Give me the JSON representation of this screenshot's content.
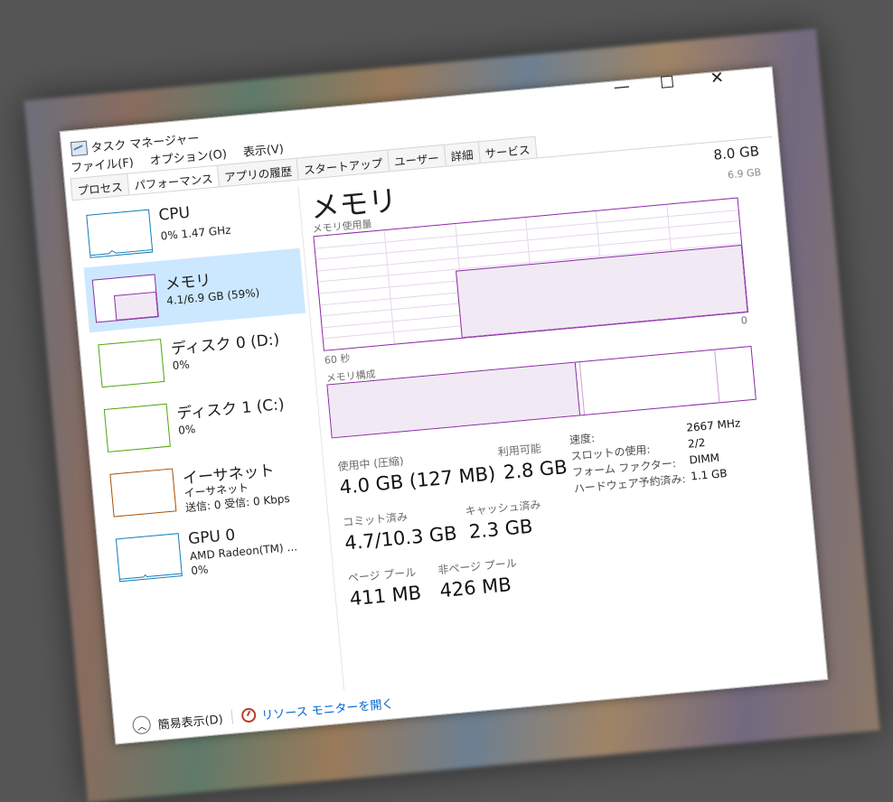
{
  "window": {
    "title": "タスク マネージャー",
    "min_glyph": "—",
    "close_glyph": "✕"
  },
  "menu": [
    "ファイル(F)",
    "オプション(O)",
    "表示(V)"
  ],
  "tabs": [
    {
      "label": "プロセス",
      "active": false
    },
    {
      "label": "パフォーマンス",
      "active": true
    },
    {
      "label": "アプリの履歴",
      "active": false
    },
    {
      "label": "スタートアップ",
      "active": false
    },
    {
      "label": "ユーザー",
      "active": false
    },
    {
      "label": "詳細",
      "active": false
    },
    {
      "label": "サービス",
      "active": false
    }
  ],
  "sidebar": [
    {
      "name": "CPU",
      "line1": "0% 1.47 GHz",
      "line2": "",
      "line3": "",
      "color": "#117dbb",
      "selected": false
    },
    {
      "name": "メモリ",
      "line1": "4.1/6.9 GB (59%)",
      "line2": "",
      "line3": "",
      "color": "#8b2aa6",
      "selected": true
    },
    {
      "name": "ディスク 0 (D:)",
      "line1": "0%",
      "line2": "",
      "line3": "",
      "color": "#4da60c",
      "selected": false
    },
    {
      "name": "ディスク 1 (C:)",
      "line1": "0%",
      "line2": "",
      "line3": "",
      "color": "#4da60c",
      "selected": false
    },
    {
      "name": "イーサネット",
      "line1": "イーサネット",
      "line2": "送信: 0 受信: 0 Kbps",
      "line3": "",
      "color": "#a74f01",
      "selected": false
    },
    {
      "name": "GPU 0",
      "line1": "AMD Radeon(TM) ...",
      "line2": "0%",
      "line3": "",
      "color": "#117dbb",
      "selected": false
    }
  ],
  "main": {
    "title": "メモリ",
    "total": "8.0 GB",
    "max_label": "6.9 GB",
    "usage_label": "メモリ使用量",
    "zero_label": "0",
    "time_label": "60 秒",
    "composition_label": "メモリ構成",
    "usage_level": 0.59,
    "composition": {
      "in_use": 0.585,
      "modified": 0.01,
      "standby": 0.32,
      "free": 0.085
    },
    "stats": {
      "in_use_label": "使用中 (圧縮)",
      "in_use_value": "4.0 GB (127 MB)",
      "available_label": "利用可能",
      "available_value": "2.8 GB",
      "committed_label": "コミット済み",
      "committed_value": "4.7/10.3 GB",
      "cached_label": "キャッシュ済み",
      "cached_value": "2.3 GB",
      "paged_label": "ページ プール",
      "paged_value": "411 MB",
      "nonpaged_label": "非ページ プール",
      "nonpaged_value": "426 MB"
    },
    "specs": [
      {
        "label": "速度:",
        "value": "2667 MHz"
      },
      {
        "label": "スロットの使用:",
        "value": "2/2"
      },
      {
        "label": "フォーム ファクター:",
        "value": "DIMM"
      },
      {
        "label": "ハードウェア予約済み:",
        "value": "1.1 GB"
      }
    ]
  },
  "footer": {
    "fewer_details": "簡易表示(D)",
    "resource_monitor": "リソース モニターを開く"
  }
}
